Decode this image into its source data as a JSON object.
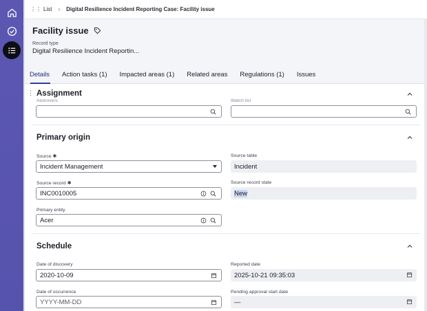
{
  "rail": {
    "items": [
      {
        "name": "home-icon"
      },
      {
        "name": "check-circle-icon"
      },
      {
        "name": "list-icon",
        "active": true
      }
    ]
  },
  "breadcrumb": {
    "list_label": "List",
    "current": "Digital Resilience Incident Reporting Case: Facility issue"
  },
  "record": {
    "title": "Facility issue",
    "type_label": "Record type",
    "type_value": "Digital Resilience Incident Reportin..."
  },
  "tabs": [
    {
      "label": "Details",
      "active": true
    },
    {
      "label": "Action tasks (1)"
    },
    {
      "label": "Impacted areas (1)"
    },
    {
      "label": "Related areas"
    },
    {
      "label": "Regulations (1)"
    },
    {
      "label": "Issues"
    }
  ],
  "sections": {
    "assignment": {
      "title": "Assignment",
      "approvers_label": "Approvers",
      "watch_list_label": "Watch list"
    },
    "primary_origin": {
      "title": "Primary origin",
      "source_label": "Source",
      "source_value": "Incident Management",
      "source_table_label": "Source table",
      "source_table_value": "Incident",
      "source_record_label": "Source record",
      "source_record_value": "INC0010005",
      "source_record_state_label": "Source record state",
      "source_record_state_value": "New",
      "primary_entity_label": "Primary entity",
      "primary_entity_value": "Acer"
    },
    "schedule": {
      "title": "Schedule",
      "date_of_discovery_label": "Date of discovery",
      "date_of_discovery_value": "2020-10-09",
      "reported_date_label": "Reported date",
      "reported_date_value": "2025-10-21 09:35:03",
      "date_of_occurrence_label": "Date of occurrence",
      "date_of_occurrence_placeholder": "YYYY-MM-DD",
      "pending_approval_label": "Pending approval start date",
      "pending_approval_value": "—"
    }
  },
  "required_marker": "✱",
  "colors": {
    "rail": "#5653ad",
    "active_tab_underline": "#2f3e9e"
  }
}
